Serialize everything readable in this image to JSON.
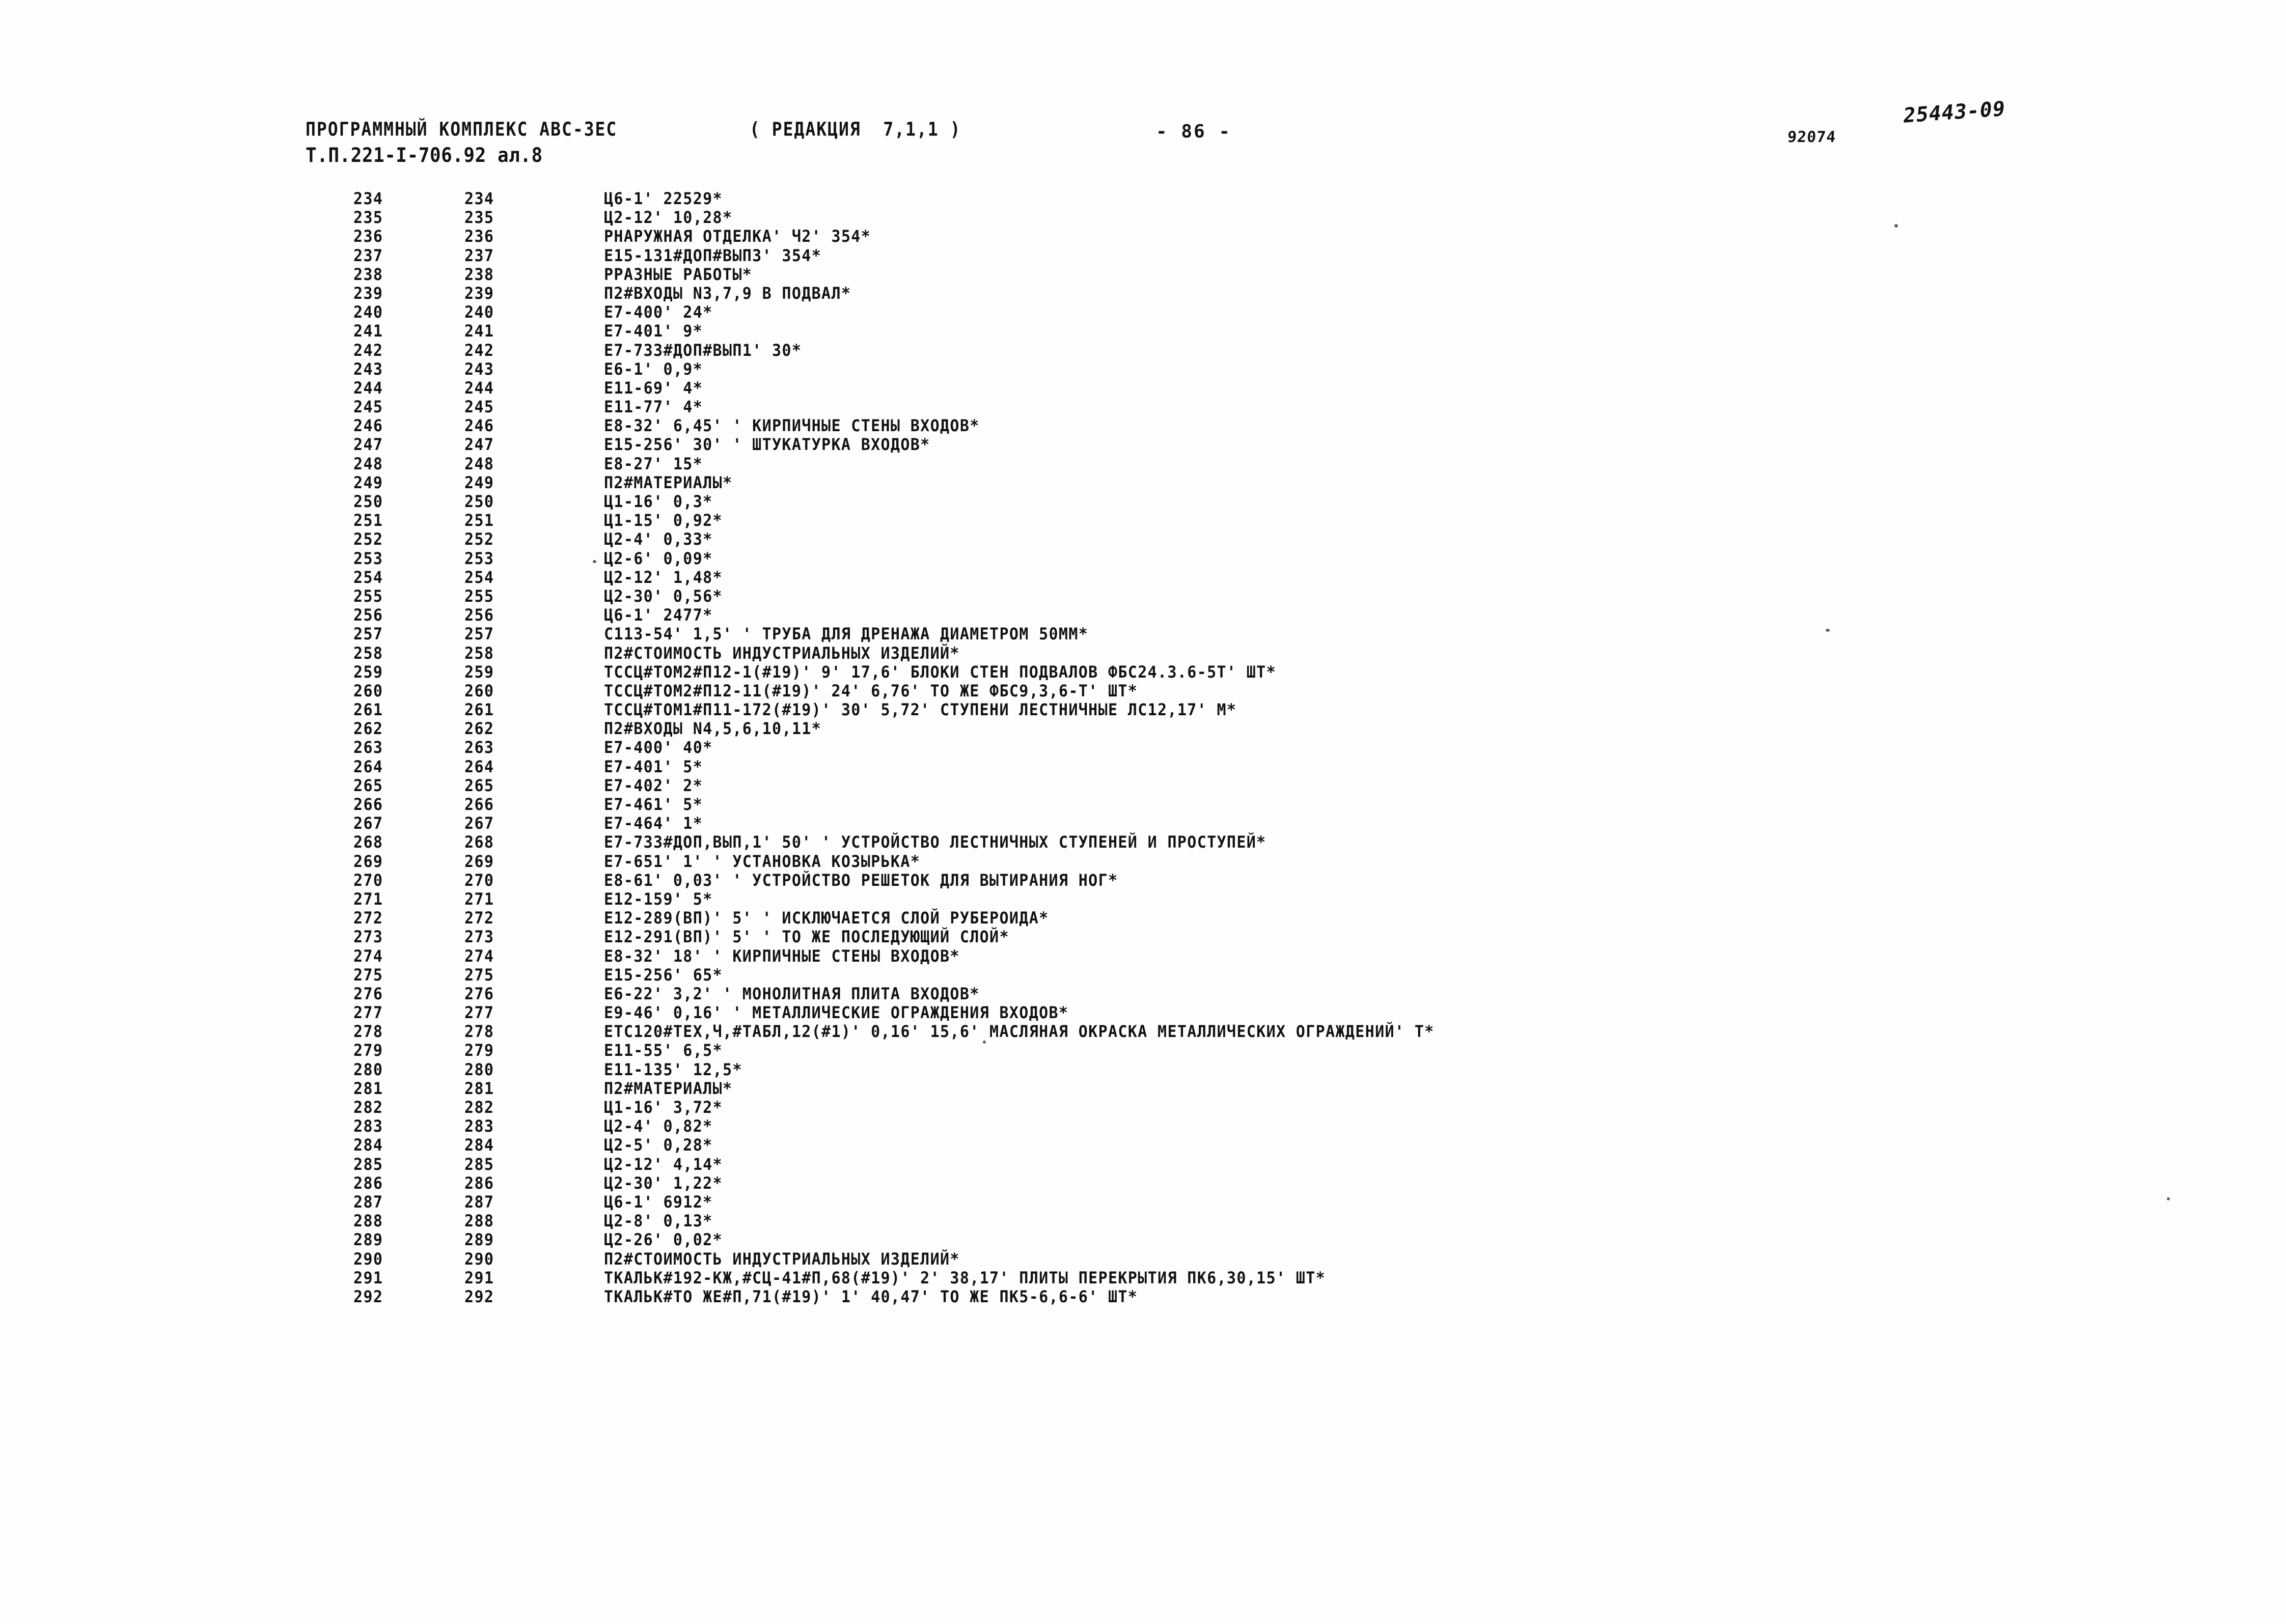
{
  "header": {
    "program_title": "ПРОГРАММНЫЙ КОМПЛЕКС АВС-3ЕС",
    "revision": "( РЕДАКЦИЯ  7,1,1 )",
    "project_code": "Т.П.221-I-706.92 ал.8",
    "page_label": "- 86 -",
    "doc_number": "92074",
    "archive_stamp": "25443-09"
  },
  "listing": {
    "rows": [
      {
        "seq": "234",
        "num": "234",
        "text": "Ц6-1' 22529*"
      },
      {
        "seq": "235",
        "num": "235",
        "text": "Ц2-12' 10,28*"
      },
      {
        "seq": "236",
        "num": "236",
        "text": "РНАРУЖНАЯ ОТДЕЛКА' Ч2' 354*"
      },
      {
        "seq": "237",
        "num": "237",
        "text": "Е15-131#ДОП#ВЫП3' 354*"
      },
      {
        "seq": "238",
        "num": "238",
        "text": "РРАЗНЫЕ РАБОТЫ*"
      },
      {
        "seq": "239",
        "num": "239",
        "text": "П2#ВХОДЫ N3,7,9 В ПОДВАЛ*"
      },
      {
        "seq": "240",
        "num": "240",
        "text": "Е7-400' 24*"
      },
      {
        "seq": "241",
        "num": "241",
        "text": "Е7-401' 9*"
      },
      {
        "seq": "242",
        "num": "242",
        "text": "Е7-733#ДОП#ВЫП1' 30*"
      },
      {
        "seq": "243",
        "num": "243",
        "text": "Е6-1' 0,9*"
      },
      {
        "seq": "244",
        "num": "244",
        "text": "Е11-69' 4*"
      },
      {
        "seq": "245",
        "num": "245",
        "text": "Е11-77' 4*"
      },
      {
        "seq": "246",
        "num": "246",
        "text": "Е8-32' 6,45' ' КИРПИЧНЫЕ СТЕНЫ ВХОДОВ*"
      },
      {
        "seq": "247",
        "num": "247",
        "text": "Е15-256' 30' ' ШТУКАТУРКА ВХОДОВ*"
      },
      {
        "seq": "248",
        "num": "248",
        "text": "Е8-27' 15*"
      },
      {
        "seq": "249",
        "num": "249",
        "text": "П2#МАТЕРИАЛЫ*"
      },
      {
        "seq": "250",
        "num": "250",
        "text": "Ц1-16' 0,3*"
      },
      {
        "seq": "251",
        "num": "251",
        "text": "Ц1-15' 0,92*"
      },
      {
        "seq": "252",
        "num": "252",
        "text": "Ц2-4' 0,33*"
      },
      {
        "seq": "253",
        "num": "253",
        "text": "Ц2-6' 0,09*"
      },
      {
        "seq": "254",
        "num": "254",
        "text": "Ц2-12' 1,48*"
      },
      {
        "seq": "255",
        "num": "255",
        "text": "Ц2-30' 0,56*"
      },
      {
        "seq": "256",
        "num": "256",
        "text": "Ц6-1' 2477*"
      },
      {
        "seq": "257",
        "num": "257",
        "text": "С113-54' 1,5' ' ТРУБА ДЛЯ ДРЕНАЖА ДИАМЕТРОМ 50ММ*"
      },
      {
        "seq": "258",
        "num": "258",
        "text": "П2#СТОИМОСТЬ ИНДУСТРИАЛЬНЫХ ИЗДЕЛИЙ*"
      },
      {
        "seq": "259",
        "num": "259",
        "text": "ТССЦ#ТОМ2#П12-1(#19)' 9' 17,6' БЛОКИ СТЕН ПОДВАЛОВ ФБС24.3.6-5Т' ШТ*"
      },
      {
        "seq": "260",
        "num": "260",
        "text": "ТССЦ#ТОМ2#П12-11(#19)' 24' 6,76' ТО ЖЕ ФБС9,3,6-Т' ШТ*"
      },
      {
        "seq": "261",
        "num": "261",
        "text": "ТССЦ#ТОМ1#П11-172(#19)' 30' 5,72' СТУПЕНИ ЛЕСТНИЧНЫЕ ЛС12,17' М*"
      },
      {
        "seq": "262",
        "num": "262",
        "text": "П2#ВХОДЫ N4,5,6,10,11*"
      },
      {
        "seq": "263",
        "num": "263",
        "text": "Е7-400' 40*"
      },
      {
        "seq": "264",
        "num": "264",
        "text": "Е7-401' 5*"
      },
      {
        "seq": "265",
        "num": "265",
        "text": "Е7-402' 2*"
      },
      {
        "seq": "266",
        "num": "266",
        "text": "Е7-461' 5*"
      },
      {
        "seq": "267",
        "num": "267",
        "text": "Е7-464' 1*"
      },
      {
        "seq": "268",
        "num": "268",
        "text": "Е7-733#ДОП,ВЫП,1' 50' ' УСТРОЙСТВО ЛЕСТНИЧНЫХ СТУПЕНЕЙ И ПРОСТУПЕЙ*"
      },
      {
        "seq": "269",
        "num": "269",
        "text": "Е7-651' 1' ' УСТАНОВКА КОЗЫРЬКА*"
      },
      {
        "seq": "270",
        "num": "270",
        "text": "Е8-61' 0,03' ' УСТРОЙСТВО РЕШЕТОК ДЛЯ ВЫТИРАНИЯ НОГ*"
      },
      {
        "seq": "271",
        "num": "271",
        "text": "Е12-159' 5*"
      },
      {
        "seq": "272",
        "num": "272",
        "text": "Е12-289(ВП)' 5' ' ИСКЛЮЧАЕТСЯ СЛОЙ РУБЕРОИДА*"
      },
      {
        "seq": "273",
        "num": "273",
        "text": "Е12-291(ВП)' 5' ' ТО ЖЕ ПОСЛЕДУЮЩИЙ СЛОЙ*"
      },
      {
        "seq": "274",
        "num": "274",
        "text": "Е8-32' 18' ' КИРПИЧНЫЕ СТЕНЫ ВХОДОВ*"
      },
      {
        "seq": "275",
        "num": "275",
        "text": "Е15-256' 65*"
      },
      {
        "seq": "276",
        "num": "276",
        "text": "Е6-22' 3,2' ' МОНОЛИТНАЯ ПЛИТА ВХОДОВ*"
      },
      {
        "seq": "277",
        "num": "277",
        "text": "Е9-46' 0,16' ' МЕТАЛЛИЧЕСКИЕ ОГРАЖДЕНИЯ ВХОДОВ*"
      },
      {
        "seq": "278",
        "num": "278",
        "text": "ЕТС120#ТЕХ,Ч,#ТАБЛ,12(#1)' 0,16' 15,6' МАСЛЯНАЯ ОКРАСКА МЕТАЛЛИЧЕСКИХ ОГРАЖДЕНИЙ' Т*"
      },
      {
        "seq": "279",
        "num": "279",
        "text": "Е11-55' 6,5*"
      },
      {
        "seq": "280",
        "num": "280",
        "text": "Е11-135' 12,5*"
      },
      {
        "seq": "281",
        "num": "281",
        "text": "П2#МАТЕРИАЛЫ*"
      },
      {
        "seq": "282",
        "num": "282",
        "text": "Ц1-16' 3,72*"
      },
      {
        "seq": "283",
        "num": "283",
        "text": "Ц2-4' 0,82*"
      },
      {
        "seq": "284",
        "num": "284",
        "text": "Ц2-5' 0,28*"
      },
      {
        "seq": "285",
        "num": "285",
        "text": "Ц2-12' 4,14*"
      },
      {
        "seq": "286",
        "num": "286",
        "text": "Ц2-30' 1,22*"
      },
      {
        "seq": "287",
        "num": "287",
        "text": "Ц6-1' 6912*"
      },
      {
        "seq": "288",
        "num": "288",
        "text": "Ц2-8' 0,13*"
      },
      {
        "seq": "289",
        "num": "289",
        "text": "Ц2-26' 0,02*"
      },
      {
        "seq": "290",
        "num": "290",
        "text": "П2#СТОИМОСТЬ ИНДУСТРИАЛЬНЫХ ИЗДЕЛИЙ*"
      },
      {
        "seq": "291",
        "num": "291",
        "text": "ТКАЛЬК#192-КЖ,#СЦ-41#П,68(#19)' 2' 38,17' ПЛИТЫ ПЕРЕКРЫТИЯ ПК6,30,15' ШТ*"
      },
      {
        "seq": "292",
        "num": "292",
        "text": "ТКАЛЬК#ТО ЖЕ#П,71(#19)' 1' 40,47' ТО ЖЕ ПК5-6,6-6' ШТ*"
      }
    ]
  }
}
